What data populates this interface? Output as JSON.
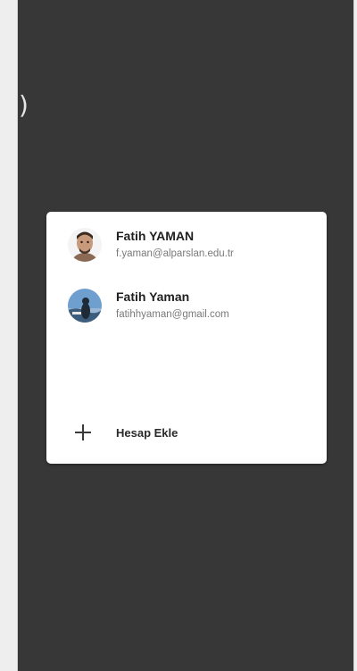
{
  "background": {
    "screen_color": "#373737",
    "frame_color": "#eeeeee",
    "edge_glyph": ")"
  },
  "account_picker": {
    "accounts": [
      {
        "name": "Fatih YAMAN",
        "email": "f.yaman@alparslan.edu.tr",
        "avatar_icon": "profile-photo"
      },
      {
        "name": "Fatih Yaman",
        "email": "fatihhyaman@gmail.com",
        "avatar_icon": "profile-photo-outdoor"
      }
    ],
    "add_account": {
      "label": "Hesap Ekle",
      "icon": "plus-icon"
    }
  }
}
